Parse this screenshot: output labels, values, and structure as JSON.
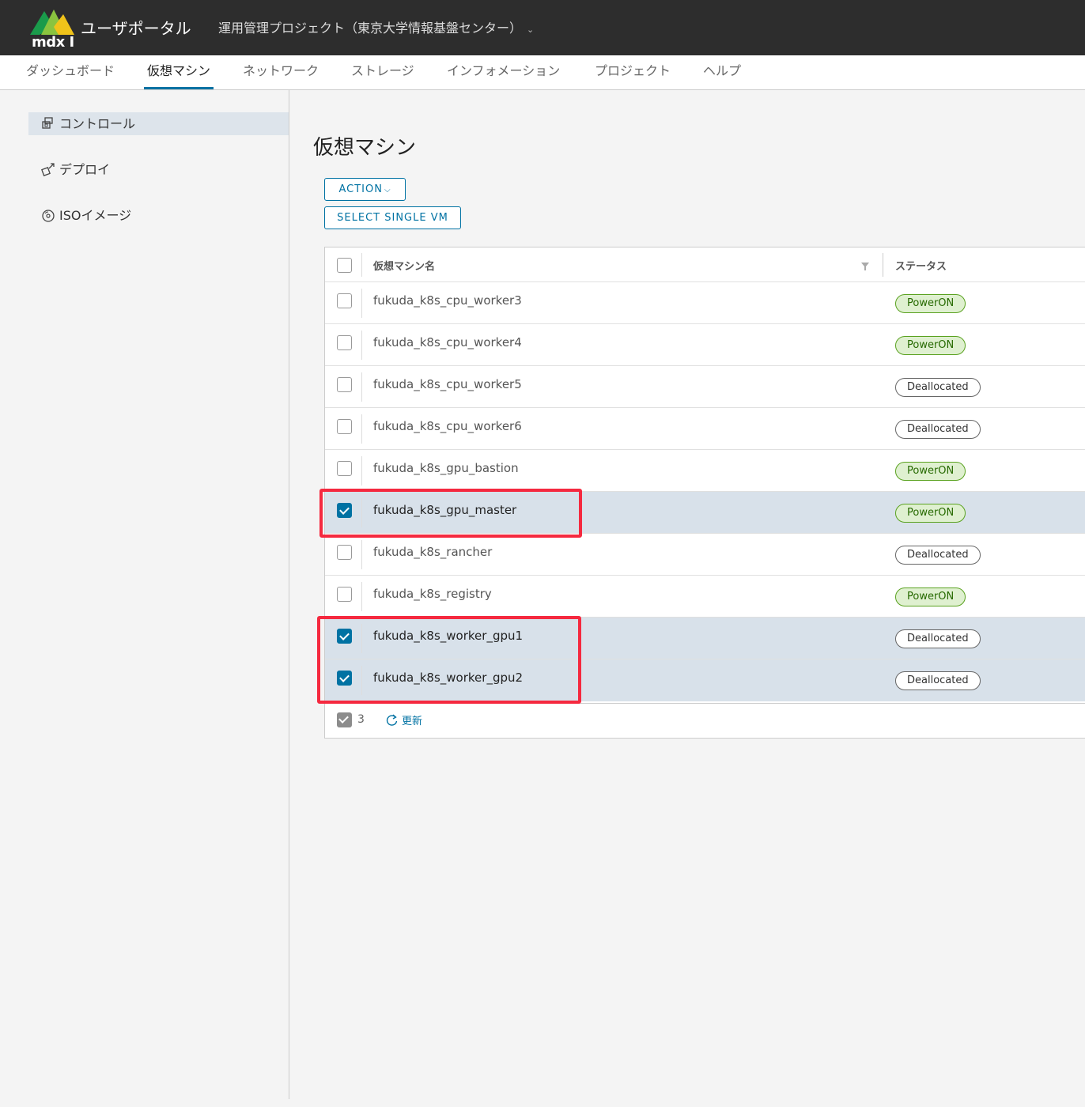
{
  "header": {
    "logo_text": "mdx I",
    "app_title": "ユーザポータル",
    "project": "運用管理プロジェクト（東京大学情報基盤センター）"
  },
  "nav": {
    "items": [
      {
        "label": "ダッシュボード"
      },
      {
        "label": "仮想マシン"
      },
      {
        "label": "ネットワーク"
      },
      {
        "label": "ストレージ"
      },
      {
        "label": "インフォメーション"
      },
      {
        "label": "プロジェクト"
      },
      {
        "label": "ヘルプ"
      }
    ],
    "active": "仮想マシン"
  },
  "sidebar": {
    "items": [
      {
        "label": "コントロール",
        "icon": "control-icon"
      },
      {
        "label": "デプロイ",
        "icon": "deploy-icon"
      },
      {
        "label": "ISOイメージ",
        "icon": "disc-icon"
      }
    ]
  },
  "main": {
    "title": "仮想マシン",
    "action_label": "ACTION",
    "select_single_label": "SELECT SINGLE VM"
  },
  "grid": {
    "columns": {
      "name": "仮想マシン名",
      "status": "ステータス"
    },
    "rows": [
      {
        "name": "fukuda_k8s_cpu_worker3",
        "status": "PowerON",
        "selected": false
      },
      {
        "name": "fukuda_k8s_cpu_worker4",
        "status": "PowerON",
        "selected": false
      },
      {
        "name": "fukuda_k8s_cpu_worker5",
        "status": "Deallocated",
        "selected": false
      },
      {
        "name": "fukuda_k8s_cpu_worker6",
        "status": "Deallocated",
        "selected": false
      },
      {
        "name": "fukuda_k8s_gpu_bastion",
        "status": "PowerON",
        "selected": false
      },
      {
        "name": "fukuda_k8s_gpu_master",
        "status": "PowerON",
        "selected": true
      },
      {
        "name": "fukuda_k8s_rancher",
        "status": "Deallocated",
        "selected": false
      },
      {
        "name": "fukuda_k8s_registry",
        "status": "PowerON",
        "selected": false
      },
      {
        "name": "fukuda_k8s_worker_gpu1",
        "status": "Deallocated",
        "selected": true
      },
      {
        "name": "fukuda_k8s_worker_gpu2",
        "status": "Deallocated",
        "selected": true
      }
    ],
    "footer": {
      "selected_count": "3",
      "refresh_label": "更新"
    }
  },
  "colors": {
    "accent": "#0072a3",
    "header_bg": "#2d2d2d",
    "highlight": "#f5293f",
    "selected_row": "#d8e1ea"
  }
}
